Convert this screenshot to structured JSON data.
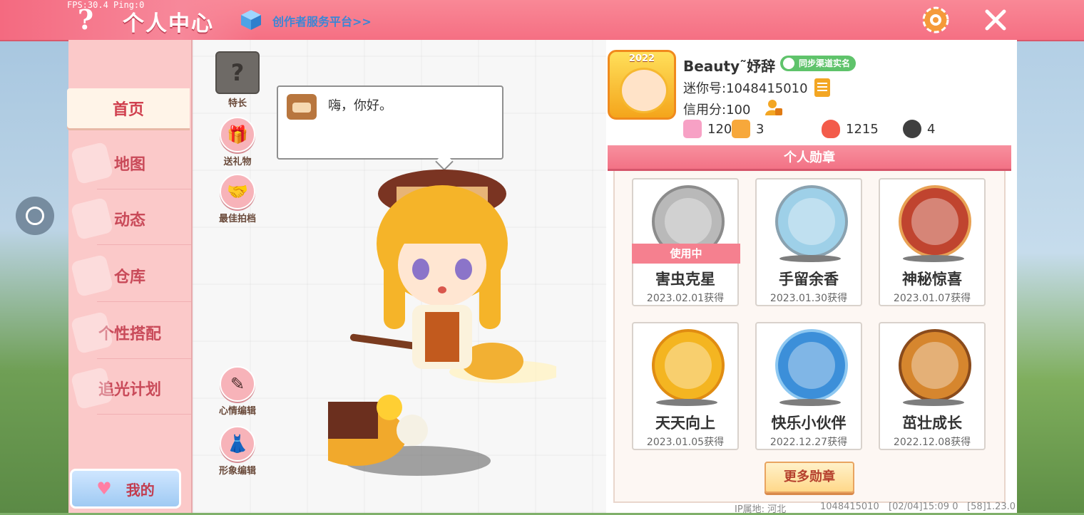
{
  "debug": {
    "fps": "FPS:30.4  Ping:0"
  },
  "header": {
    "help_label": "?",
    "title": "个人中心",
    "creator_link": "创作者服务平台>>",
    "accent": "#f56f83"
  },
  "sidebar": {
    "items": [
      {
        "label": "首页",
        "active": true
      },
      {
        "label": "地图"
      },
      {
        "label": "动态"
      },
      {
        "label": "仓库"
      },
      {
        "label": "个性搭配"
      },
      {
        "label": "追光计划"
      }
    ],
    "my_button": "我的"
  },
  "stage": {
    "buttons": {
      "talent": "特长",
      "gift": "送礼物",
      "partner": "最佳拍档",
      "mood_edit": "心情编辑",
      "look_edit": "形象编辑"
    },
    "speech": "嗨，你好。"
  },
  "profile": {
    "year_badge": "2022",
    "username": "Beauty˜妤辞",
    "realname_badge": "同步渠道实名",
    "mini_id": "迷你号:1048415010",
    "credit": "信用分:100",
    "stats": {
      "stat1": "120",
      "stat2": "3",
      "popularity": "1215",
      "likes": "4"
    }
  },
  "medals": {
    "header": "个人勋章",
    "in_use_label": "使用中",
    "items": [
      {
        "name": "害虫克星",
        "date": "2023.02.01获得",
        "color": "#b9b9b9"
      },
      {
        "name": "手留余香",
        "date": "2023.01.30获得",
        "color": "#9ed0e8"
      },
      {
        "name": "神秘惊喜",
        "date": "2023.01.07获得",
        "color": "#c0442f"
      },
      {
        "name": "天天向上",
        "date": "2023.01.05获得",
        "color": "#f4b521"
      },
      {
        "name": "快乐小伙伴",
        "date": "2022.12.27获得",
        "color": "#3c8fd9"
      },
      {
        "name": "茁壮成长",
        "date": "2022.12.08获得",
        "color": "#d6862e"
      }
    ],
    "more_button": "更多勋章"
  },
  "footer": {
    "ip": "IP属地: 河北",
    "uid": "1048415010",
    "time": "[02/04]15:09 0",
    "version": "[58]1.23.0"
  }
}
